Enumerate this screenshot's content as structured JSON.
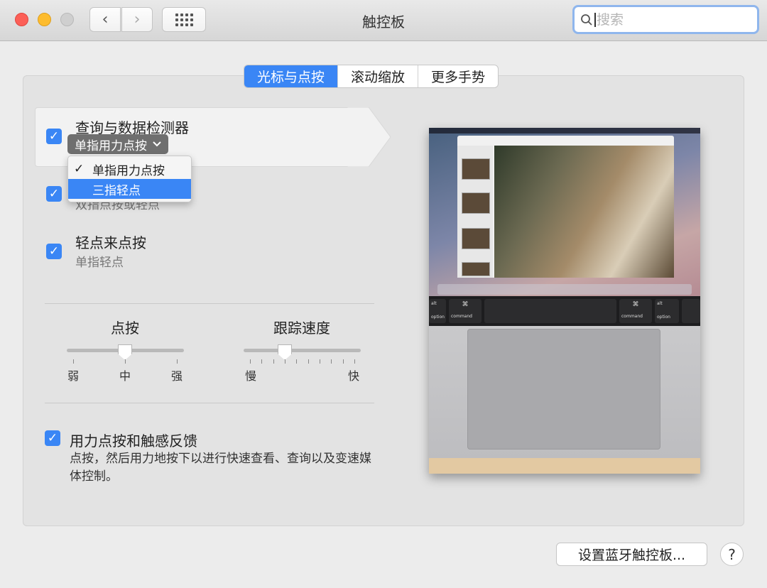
{
  "window": {
    "title": "触控板",
    "search_placeholder": "搜索",
    "controls": {
      "back": "‹",
      "forward": "›"
    }
  },
  "tabs": [
    {
      "label": "光标与点按",
      "active": true
    },
    {
      "label": "滚动缩放",
      "active": false
    },
    {
      "label": "更多手势",
      "active": false
    }
  ],
  "options": {
    "lookup": {
      "label": "查询与数据检测器",
      "checked": true,
      "selected": "单指用力点按"
    },
    "secondary": {
      "checked": true,
      "sublabel_partial": "双指点按或轻点"
    },
    "tap": {
      "label": "轻点来点按",
      "sublabel": "单指轻点",
      "checked": true
    },
    "force": {
      "label": "用力点按和触感反馈",
      "checked": true,
      "description": "点按，然后用力地按下以进行快速查看、查询以及变速媒体控制。"
    }
  },
  "popup_menu": {
    "items": [
      {
        "label": "单指用力点按",
        "checked": true,
        "highlighted": false
      },
      {
        "label": "三指轻点",
        "checked": false,
        "highlighted": true
      }
    ]
  },
  "sliders": {
    "click": {
      "title": "点按",
      "min_label": "弱",
      "mid_label": "中",
      "max_label": "强",
      "level": 0.5
    },
    "tracking": {
      "title": "跟踪速度",
      "min_label": "慢",
      "max_label": "快",
      "level": 0.34
    }
  },
  "preview": {
    "keys": {
      "left_fn": "⌘",
      "left_label": "command",
      "left_alt": "alt",
      "left_option": "option",
      "right_fn": "⌘",
      "right_label": "command",
      "right_alt": "alt",
      "right_option": "option"
    }
  },
  "footer": {
    "bluetooth_button": "设置蓝牙触控板...",
    "help_button": "?"
  },
  "colors": {
    "accent": "#3a86f5"
  }
}
